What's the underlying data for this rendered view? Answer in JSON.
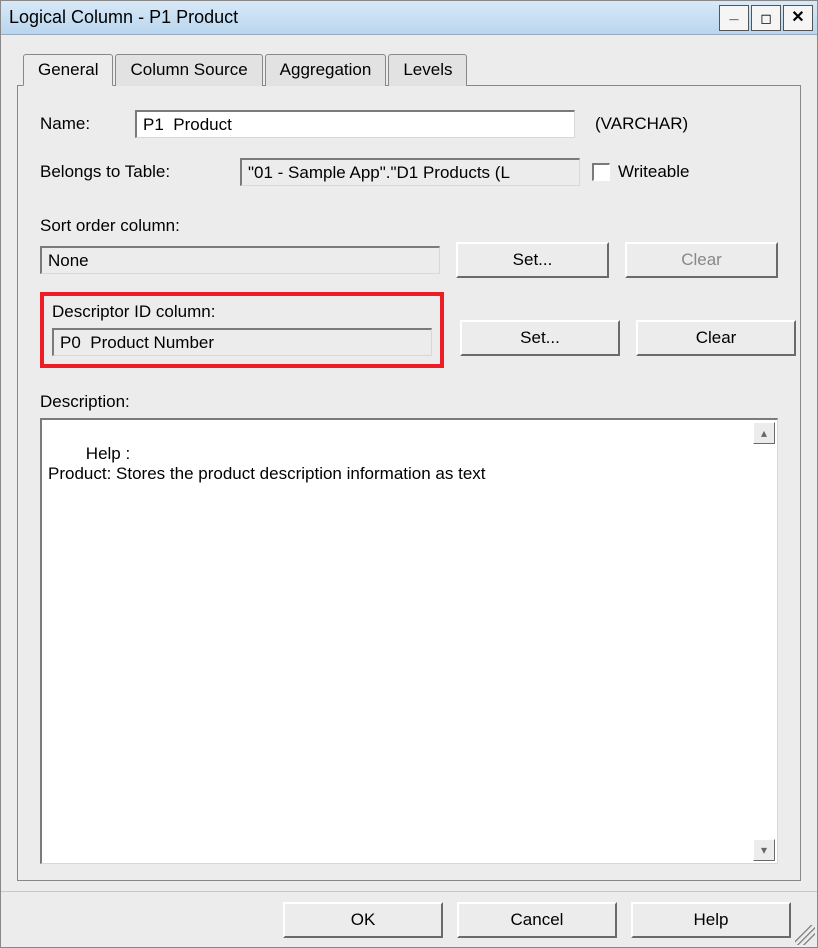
{
  "window": {
    "title": "Logical Column - P1  Product"
  },
  "tabs": [
    {
      "label": "General",
      "active": true
    },
    {
      "label": "Column Source",
      "active": false
    },
    {
      "label": "Aggregation",
      "active": false
    },
    {
      "label": "Levels",
      "active": false
    }
  ],
  "general": {
    "name_label": "Name:",
    "name_value": "P1  Product",
    "datatype": "(VARCHAR)",
    "belongs_label": "Belongs to Table:",
    "belongs_value": "\"01 - Sample App\".\"D1 Products (L",
    "writeable_label": "Writeable",
    "writeable_checked": false,
    "sort_label": "Sort order column:",
    "sort_value": "None",
    "sort_set_btn": "Set...",
    "sort_clear_btn": "Clear",
    "desc_id_label": "Descriptor ID column:",
    "desc_id_value": "P0  Product Number",
    "desc_id_set_btn": "Set...",
    "desc_id_clear_btn": "Clear",
    "description_label": "Description:",
    "description_text": "Help :\nProduct: Stores the product description information as text"
  },
  "buttons": {
    "ok": "OK",
    "cancel": "Cancel",
    "help": "Help"
  }
}
